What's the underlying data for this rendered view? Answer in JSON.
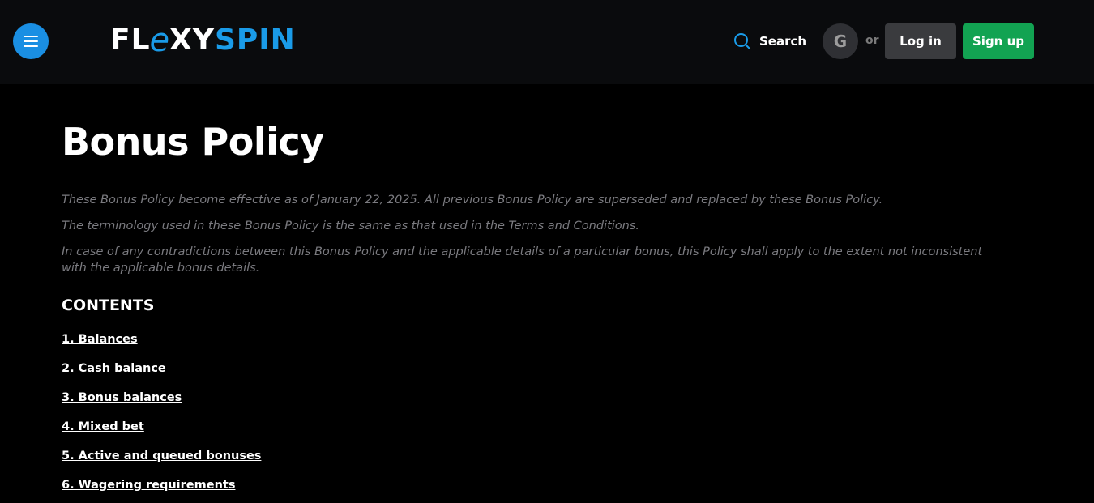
{
  "header": {
    "logo": {
      "part1": "FL",
      "part2": "e",
      "part3": "XY",
      "part4": "SPIN"
    },
    "search_label": "Search",
    "google_letter": "G",
    "or_label": "or",
    "login_label": "Log in",
    "signup_label": "Sign up"
  },
  "page": {
    "title": "Bonus Policy",
    "intro": [
      "These Bonus Policy become effective as of January 22, 2025. All previous Bonus Policy are superseded and replaced by these Bonus Policy.",
      "The terminology used in these Bonus Policy is the same as that used in the Terms and Conditions.",
      "In case of any contradictions between this Bonus Policy and the applicable details of a particular bonus, this Policy shall apply to the extent not inconsistent with the applicable bonus details."
    ],
    "contents_heading": "CONTENTS",
    "toc": [
      "1. Balances",
      "2. Cash balance",
      "3. Bonus balances",
      "4. Mixed bet",
      "5. Active and queued bonuses",
      "6. Wagering requirements"
    ]
  },
  "colors": {
    "accent": "#1a8fe3",
    "signup": "#12a352",
    "login": "#3a3b3e",
    "header_bg": "#0a0b0d",
    "page_bg": "#000000",
    "muted_text": "#7b7b80"
  },
  "icons": {
    "menu": "hamburger-icon",
    "search": "search-icon",
    "google": "google-icon"
  }
}
